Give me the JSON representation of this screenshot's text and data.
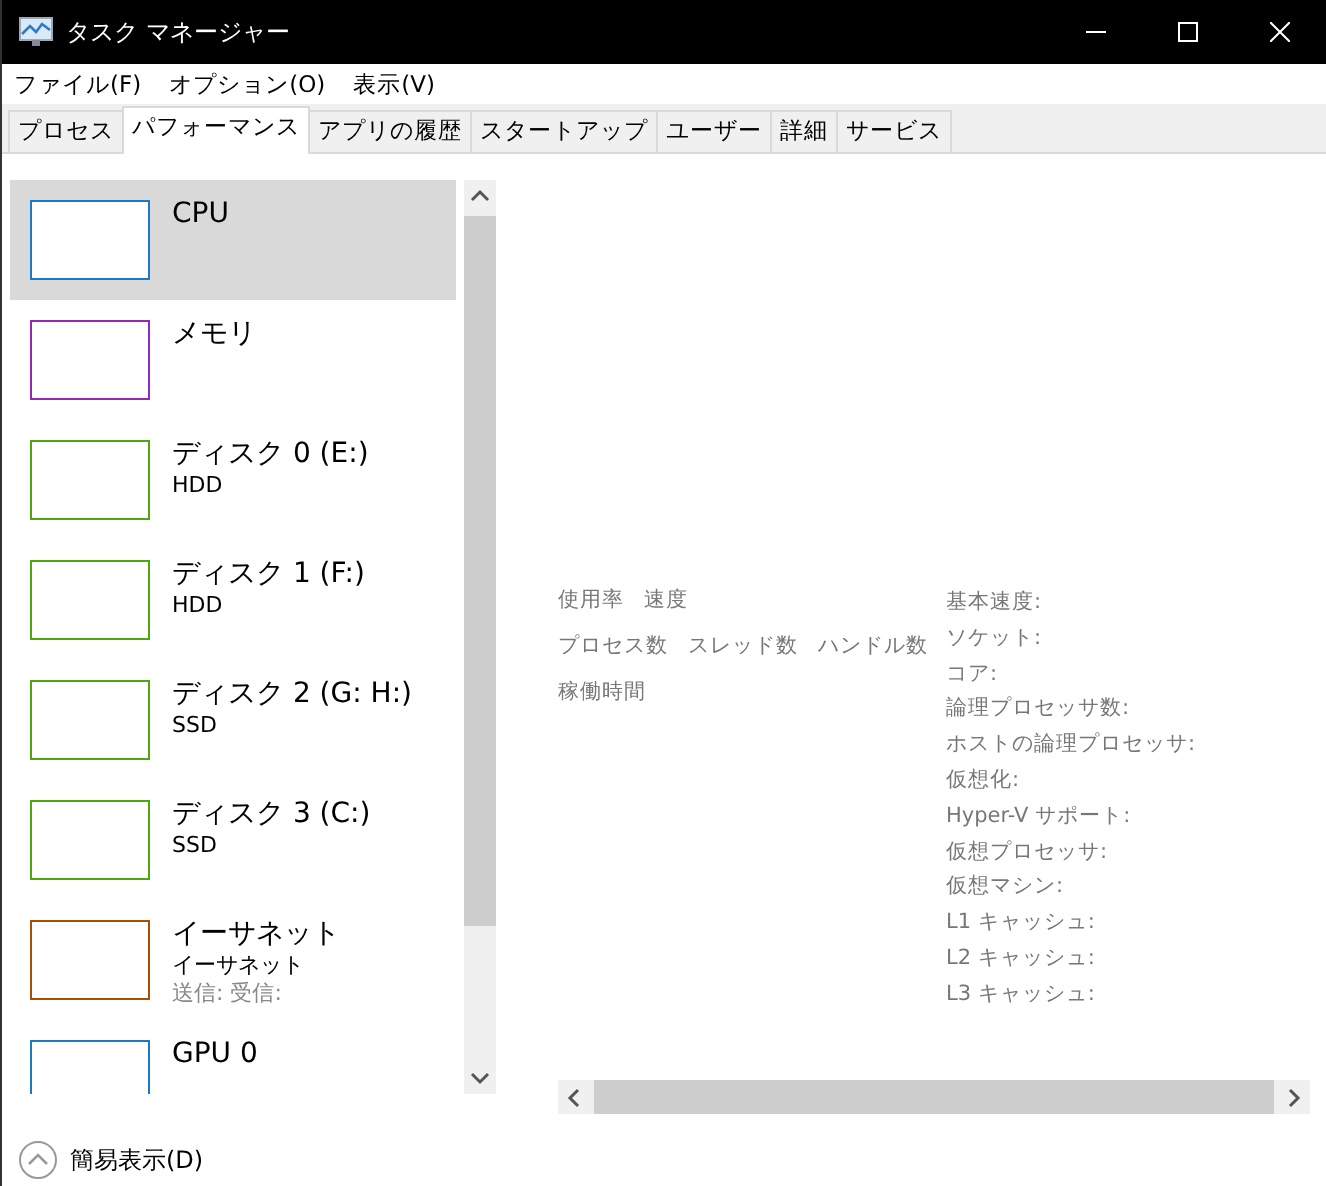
{
  "window": {
    "title": "タスク マネージャー"
  },
  "menu": [
    "ファイル(F)",
    "オプション(O)",
    "表示(V)"
  ],
  "tabs": [
    {
      "label": "プロセス",
      "selected": false
    },
    {
      "label": "パフォーマンス",
      "selected": true
    },
    {
      "label": "アプリの履歴",
      "selected": false
    },
    {
      "label": "スタートアップ",
      "selected": false
    },
    {
      "label": "ユーザー",
      "selected": false
    },
    {
      "label": "詳細",
      "selected": false
    },
    {
      "label": "サービス",
      "selected": false
    }
  ],
  "sidebar": {
    "items": [
      {
        "title": "CPU",
        "selected": true,
        "color": "#1a7bc4"
      },
      {
        "title": "メモリ",
        "selected": false,
        "color": "#9528b4"
      },
      {
        "title": "ディスク 0 (E:)",
        "subtitle": "HDD",
        "selected": false,
        "color": "#4da60c"
      },
      {
        "title": "ディスク 1 (F:)",
        "subtitle": "HDD",
        "selected": false,
        "color": "#4da60c"
      },
      {
        "title": "ディスク 2 (G: H:)",
        "subtitle": "SSD",
        "selected": false,
        "color": "#4da60c"
      },
      {
        "title": "ディスク 3 (C:)",
        "subtitle": "SSD",
        "selected": false,
        "color": "#4da60c"
      },
      {
        "title": "イーサネット",
        "subtitle": "イーサネット",
        "detail": "送信: 受信:",
        "selected": false,
        "color": "#a74f01"
      },
      {
        "title": "GPU 0",
        "selected": false,
        "color": "#1a7bc4"
      }
    ]
  },
  "stats": {
    "rows": [
      [
        "使用率",
        "速度"
      ],
      [
        "プロセス数",
        "スレッド数",
        "ハンドル数"
      ],
      [
        "稼働時間"
      ]
    ],
    "specs": [
      "基本速度:",
      "ソケット:",
      "コア:",
      "論理プロセッサ数:",
      "ホストの論理プロセッサ:",
      "仮想化:",
      "Hyper-V サポート:",
      "仮想プロセッサ:",
      "仮想マシン:",
      "L1 キャッシュ:",
      "L2 キャッシュ:",
      "L3 キャッシュ:"
    ]
  },
  "footer": {
    "label": "簡易表示(D)"
  }
}
